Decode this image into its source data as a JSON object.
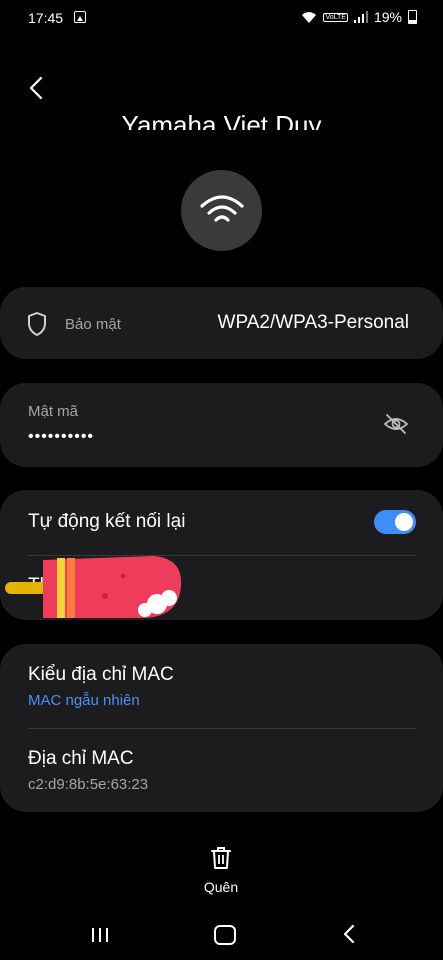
{
  "status_bar": {
    "time": "17:45",
    "volte": "VoLTE",
    "battery": "19%",
    "icons": [
      "gallery-icon",
      "wifi-signal-icon",
      "volte-icon",
      "cell-signal-icon",
      "battery-icon"
    ]
  },
  "header": {
    "back_icon": "back-arrow-icon",
    "network_name": "Yamaha Viet Duy"
  },
  "security": {
    "label": "Bảo mật",
    "value": "WPA2/WPA3-Personal",
    "icon": "shield-icon"
  },
  "password": {
    "label": "Mật mã",
    "value": "••••••••••",
    "icon": "eye-off-icon"
  },
  "auto_reconnect": {
    "label": "Tự động kết nối lại",
    "enabled": true,
    "second_row_label": "Th"
  },
  "mac": {
    "type_label": "Kiểu địa chỉ MAC",
    "type_value": "MAC ngẫu nhiên",
    "address_label": "Địa chỉ MAC",
    "address_value": "c2:d9:8b:5e:63:23"
  },
  "forget": {
    "label": "Quên",
    "icon": "trash-icon"
  },
  "nav_bar": {
    "icons": [
      "recent-apps-icon",
      "home-icon",
      "back-icon"
    ]
  },
  "colors": {
    "background": "#000000",
    "card": "#1c1c1e",
    "accent": "#3e8ef7",
    "link": "#4f8ef7",
    "secondary_text": "#a5a5a8"
  }
}
